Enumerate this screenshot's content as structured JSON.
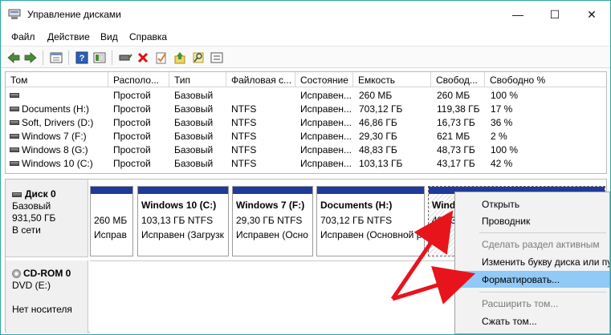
{
  "window": {
    "title": "Управление дисками",
    "controls": {
      "minimize": "—",
      "maximize": "☐",
      "close": "✕"
    }
  },
  "menu": [
    "Файл",
    "Действие",
    "Вид",
    "Справка"
  ],
  "toolbar_icons": [
    "back-arrow-icon",
    "forward-arrow-icon",
    "properties-icon",
    "help-icon",
    "view-icon",
    "connect-icon",
    "delete-icon",
    "checklist-icon",
    "import-icon",
    "search-icon",
    "options-icon"
  ],
  "volume_list": {
    "columns": [
      "Том",
      "Располо...",
      "Тип",
      "Файловая с...",
      "Состояние",
      "Емкость",
      "Свобод...",
      "Свободно %"
    ],
    "rows": [
      [
        "",
        "Простой",
        "Базовый",
        "",
        "Исправен...",
        "260 МБ",
        "260 МБ",
        "100 %"
      ],
      [
        "Documents (H:)",
        "Простой",
        "Базовый",
        "NTFS",
        "Исправен...",
        "703,12 ГБ",
        "119,38 ГБ",
        "17 %"
      ],
      [
        "Soft, Drivers (D:)",
        "Простой",
        "Базовый",
        "NTFS",
        "Исправен...",
        "46,86 ГБ",
        "16,73 ГБ",
        "36 %"
      ],
      [
        "Windows 7 (F:)",
        "Простой",
        "Базовый",
        "NTFS",
        "Исправен...",
        "29,30 ГБ",
        "621 МБ",
        "2 %"
      ],
      [
        "Windows 8 (G:)",
        "Простой",
        "Базовый",
        "NTFS",
        "Исправен...",
        "48,83 ГБ",
        "48,73 ГБ",
        "100 %"
      ],
      [
        "Windows 10 (C:)",
        "Простой",
        "Базовый",
        "NTFS",
        "Исправен...",
        "103,13 ГБ",
        "43,17 ГБ",
        "42 %"
      ]
    ]
  },
  "disk0": {
    "name": "Диск 0",
    "type": "Базовый",
    "size": "931,50 ГБ",
    "status": "В сети",
    "partitions": [
      {
        "name": "",
        "size": "260 МБ",
        "status": "Исправ"
      },
      {
        "name": "Windows 10  (C:)",
        "size": "103,13 ГБ NTFS",
        "status": "Исправен (Загрузк"
      },
      {
        "name": "Windows 7  (F:)",
        "size": "29,30 ГБ NTFS",
        "status": "Исправен (Осно"
      },
      {
        "name": "Documents  (H:)",
        "size": "703,12 ГБ NTFS",
        "status": "Исправен (Основной р"
      },
      {
        "name": "Wind",
        "size": "48,83",
        "status": ""
      }
    ]
  },
  "cdrom": {
    "name": "CD-ROM 0",
    "type": "DVD (E:)",
    "status": "Нет носителя"
  },
  "context_menu": {
    "items": [
      {
        "label": "Открыть",
        "disabled": false
      },
      {
        "label": "Проводник",
        "disabled": false
      },
      {
        "label": "Сделать раздел активным",
        "disabled": true
      },
      {
        "label": "Изменить букву диска или пу",
        "disabled": false
      },
      {
        "label": "Форматировать...",
        "disabled": false,
        "highlighted": true
      },
      {
        "label": "Расширить том...",
        "disabled": true
      },
      {
        "label": "Сжать том...",
        "disabled": false
      }
    ]
  },
  "colors": {
    "accent_bar": "#1f3a9a",
    "highlight": "#91c9f7",
    "annotation_arrow": "#e8141c"
  }
}
